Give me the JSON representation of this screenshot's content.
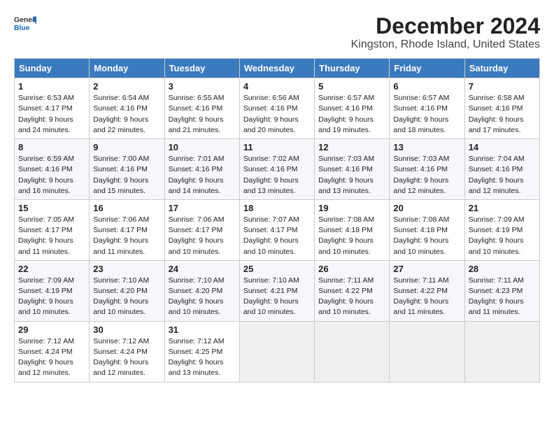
{
  "header": {
    "logo_general": "General",
    "logo_blue": "Blue",
    "month": "December 2024",
    "location": "Kingston, Rhode Island, United States"
  },
  "weekdays": [
    "Sunday",
    "Monday",
    "Tuesday",
    "Wednesday",
    "Thursday",
    "Friday",
    "Saturday"
  ],
  "weeks": [
    [
      {
        "day": "1",
        "sunrise": "6:53 AM",
        "sunset": "4:17 PM",
        "daylight": "9 hours and 24 minutes."
      },
      {
        "day": "2",
        "sunrise": "6:54 AM",
        "sunset": "4:16 PM",
        "daylight": "9 hours and 22 minutes."
      },
      {
        "day": "3",
        "sunrise": "6:55 AM",
        "sunset": "4:16 PM",
        "daylight": "9 hours and 21 minutes."
      },
      {
        "day": "4",
        "sunrise": "6:56 AM",
        "sunset": "4:16 PM",
        "daylight": "9 hours and 20 minutes."
      },
      {
        "day": "5",
        "sunrise": "6:57 AM",
        "sunset": "4:16 PM",
        "daylight": "9 hours and 19 minutes."
      },
      {
        "day": "6",
        "sunrise": "6:57 AM",
        "sunset": "4:16 PM",
        "daylight": "9 hours and 18 minutes."
      },
      {
        "day": "7",
        "sunrise": "6:58 AM",
        "sunset": "4:16 PM",
        "daylight": "9 hours and 17 minutes."
      }
    ],
    [
      {
        "day": "8",
        "sunrise": "6:59 AM",
        "sunset": "4:16 PM",
        "daylight": "9 hours and 16 minutes."
      },
      {
        "day": "9",
        "sunrise": "7:00 AM",
        "sunset": "4:16 PM",
        "daylight": "9 hours and 15 minutes."
      },
      {
        "day": "10",
        "sunrise": "7:01 AM",
        "sunset": "4:16 PM",
        "daylight": "9 hours and 14 minutes."
      },
      {
        "day": "11",
        "sunrise": "7:02 AM",
        "sunset": "4:16 PM",
        "daylight": "9 hours and 13 minutes."
      },
      {
        "day": "12",
        "sunrise": "7:03 AM",
        "sunset": "4:16 PM",
        "daylight": "9 hours and 13 minutes."
      },
      {
        "day": "13",
        "sunrise": "7:03 AM",
        "sunset": "4:16 PM",
        "daylight": "9 hours and 12 minutes."
      },
      {
        "day": "14",
        "sunrise": "7:04 AM",
        "sunset": "4:16 PM",
        "daylight": "9 hours and 12 minutes."
      }
    ],
    [
      {
        "day": "15",
        "sunrise": "7:05 AM",
        "sunset": "4:17 PM",
        "daylight": "9 hours and 11 minutes."
      },
      {
        "day": "16",
        "sunrise": "7:06 AM",
        "sunset": "4:17 PM",
        "daylight": "9 hours and 11 minutes."
      },
      {
        "day": "17",
        "sunrise": "7:06 AM",
        "sunset": "4:17 PM",
        "daylight": "9 hours and 10 minutes."
      },
      {
        "day": "18",
        "sunrise": "7:07 AM",
        "sunset": "4:17 PM",
        "daylight": "9 hours and 10 minutes."
      },
      {
        "day": "19",
        "sunrise": "7:08 AM",
        "sunset": "4:18 PM",
        "daylight": "9 hours and 10 minutes."
      },
      {
        "day": "20",
        "sunrise": "7:08 AM",
        "sunset": "4:18 PM",
        "daylight": "9 hours and 10 minutes."
      },
      {
        "day": "21",
        "sunrise": "7:09 AM",
        "sunset": "4:19 PM",
        "daylight": "9 hours and 10 minutes."
      }
    ],
    [
      {
        "day": "22",
        "sunrise": "7:09 AM",
        "sunset": "4:19 PM",
        "daylight": "9 hours and 10 minutes."
      },
      {
        "day": "23",
        "sunrise": "7:10 AM",
        "sunset": "4:20 PM",
        "daylight": "9 hours and 10 minutes."
      },
      {
        "day": "24",
        "sunrise": "7:10 AM",
        "sunset": "4:20 PM",
        "daylight": "9 hours and 10 minutes."
      },
      {
        "day": "25",
        "sunrise": "7:10 AM",
        "sunset": "4:21 PM",
        "daylight": "9 hours and 10 minutes."
      },
      {
        "day": "26",
        "sunrise": "7:11 AM",
        "sunset": "4:22 PM",
        "daylight": "9 hours and 10 minutes."
      },
      {
        "day": "27",
        "sunrise": "7:11 AM",
        "sunset": "4:22 PM",
        "daylight": "9 hours and 11 minutes."
      },
      {
        "day": "28",
        "sunrise": "7:11 AM",
        "sunset": "4:23 PM",
        "daylight": "9 hours and 11 minutes."
      }
    ],
    [
      {
        "day": "29",
        "sunrise": "7:12 AM",
        "sunset": "4:24 PM",
        "daylight": "9 hours and 12 minutes."
      },
      {
        "day": "30",
        "sunrise": "7:12 AM",
        "sunset": "4:24 PM",
        "daylight": "9 hours and 12 minutes."
      },
      {
        "day": "31",
        "sunrise": "7:12 AM",
        "sunset": "4:25 PM",
        "daylight": "9 hours and 13 minutes."
      },
      null,
      null,
      null,
      null
    ]
  ]
}
